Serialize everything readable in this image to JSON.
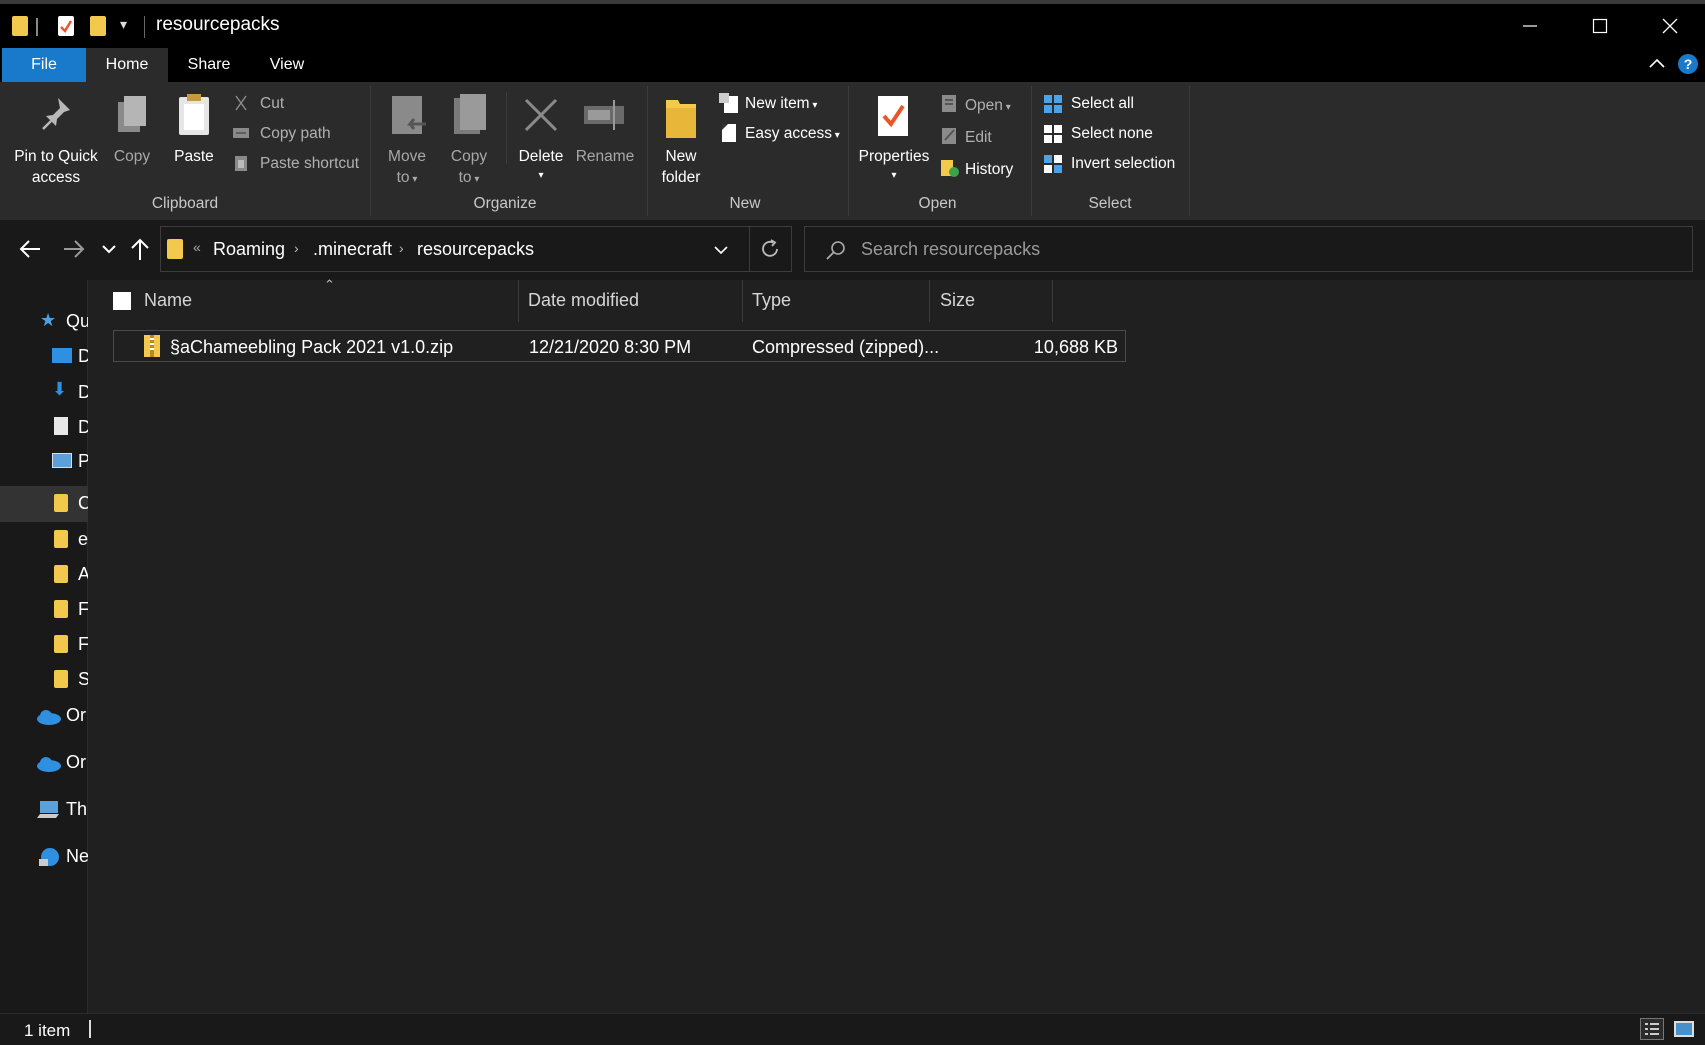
{
  "window": {
    "title": "resourcepacks",
    "controls": {
      "minimize": "minimize",
      "maximize": "maximize",
      "close": "close"
    }
  },
  "tabs": [
    {
      "label": "File"
    },
    {
      "label": "Home"
    },
    {
      "label": "Share"
    },
    {
      "label": "View"
    }
  ],
  "ribbon": {
    "clipboard": {
      "pin_line1": "Pin to Quick",
      "pin_line2": "access",
      "copy": "Copy",
      "paste": "Paste",
      "cut": "Cut",
      "copy_path": "Copy path",
      "paste_shortcut": "Paste shortcut",
      "group": "Clipboard"
    },
    "organize": {
      "move_line1": "Move",
      "move_line2": "to",
      "copy_line1": "Copy",
      "copy_line2": "to",
      "delete": "Delete",
      "rename": "Rename",
      "group": "Organize"
    },
    "new": {
      "folder_line1": "New",
      "folder_line2": "folder",
      "new_item": "New item",
      "easy_access": "Easy access",
      "group": "New"
    },
    "open": {
      "properties": "Properties",
      "open": "Open",
      "edit": "Edit",
      "history": "History",
      "group": "Open"
    },
    "select": {
      "select_all": "Select all",
      "select_none": "Select none",
      "invert": "Invert selection",
      "group": "Select"
    }
  },
  "address": {
    "overflow": "«",
    "crumbs": [
      "Roaming",
      ".minecraft",
      "resourcepacks"
    ],
    "search_placeholder": "Search resourcepacks"
  },
  "nav": {
    "items": [
      "Qu",
      "D",
      "D",
      "D",
      "P",
      "C",
      "e",
      "A",
      "F",
      "F",
      "S",
      "Or",
      "Or",
      "Th",
      "Ne"
    ]
  },
  "columns": {
    "name": "Name",
    "date": "Date modified",
    "type": "Type",
    "size": "Size"
  },
  "files": [
    {
      "name": "§aChameebling Pack 2021 v1.0.zip",
      "date": "12/21/2020 8:30 PM",
      "type": "Compressed (zipped)...",
      "size": "10,688 KB"
    }
  ],
  "status": {
    "count": "1 item"
  },
  "colors": {
    "accent": "#1979ca",
    "folder": "#f2c94c",
    "background": "#191919",
    "ribbon": "#2b2b2b"
  }
}
